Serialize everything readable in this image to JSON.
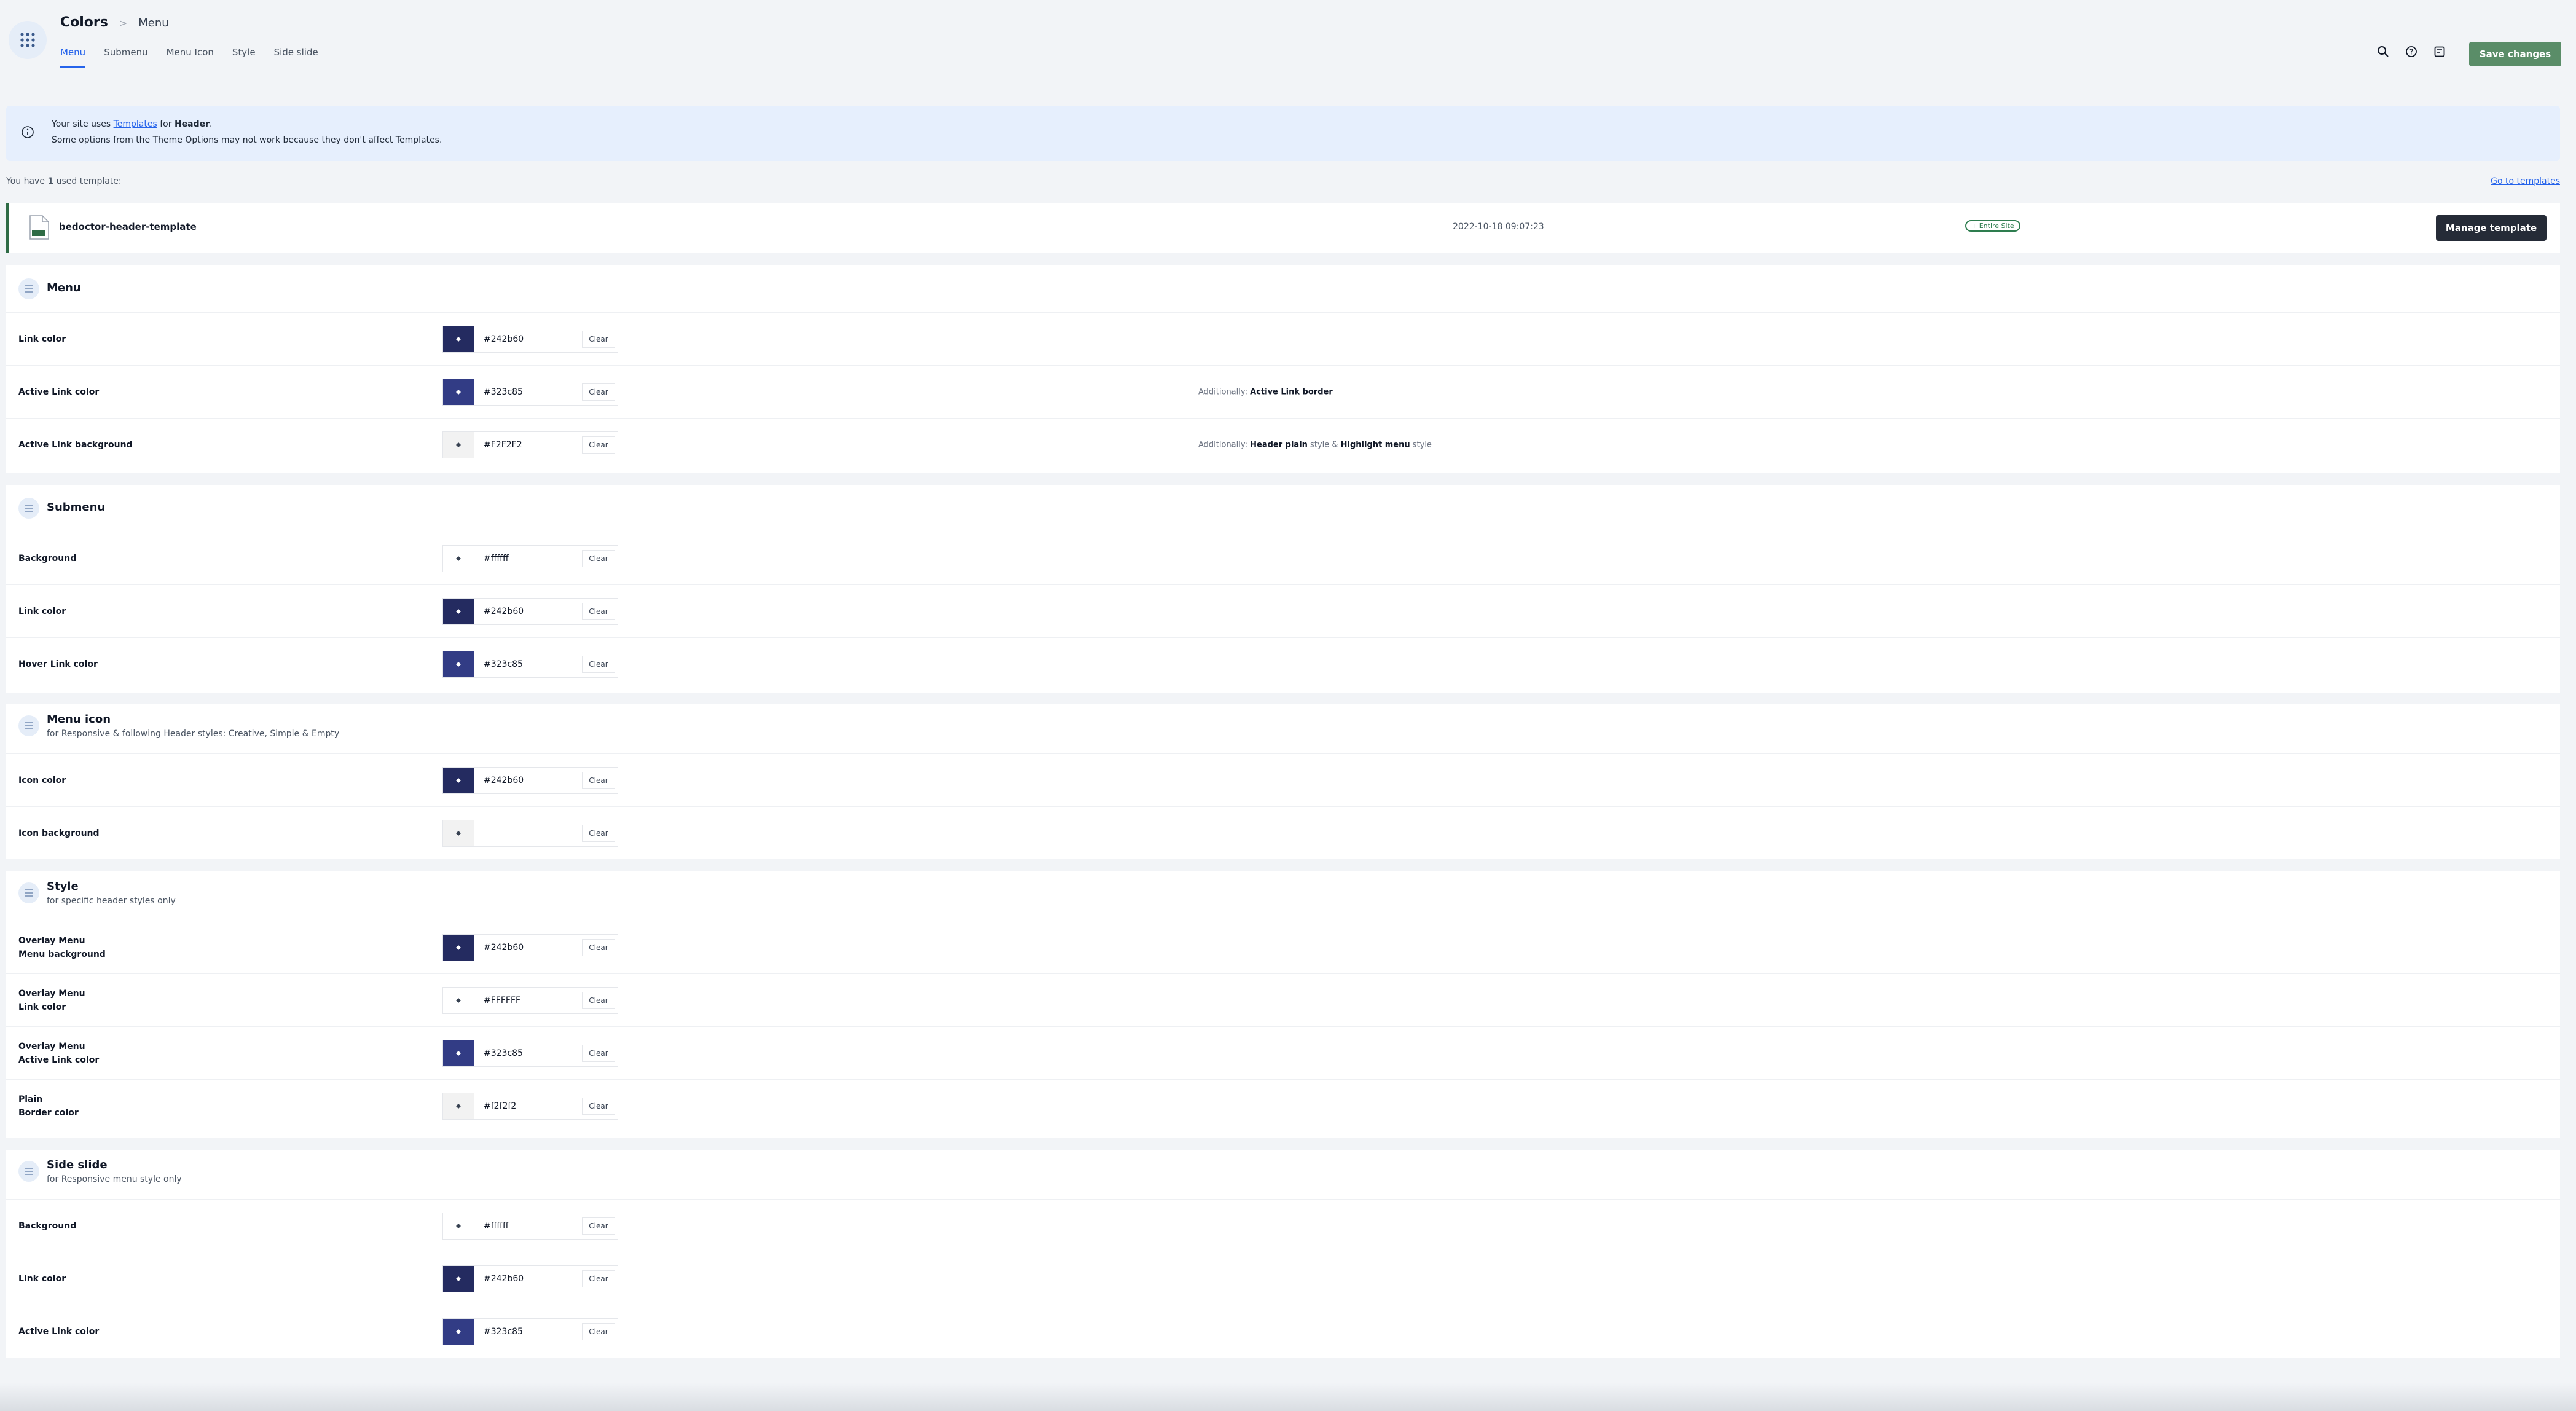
{
  "header": {
    "breadcrumb_main": "Colors",
    "breadcrumb_sep": ">",
    "breadcrumb_sub": "Menu",
    "tabs": [
      {
        "label": "Menu",
        "active": true
      },
      {
        "label": "Submenu",
        "active": false
      },
      {
        "label": "Menu Icon",
        "active": false
      },
      {
        "label": "Style",
        "active": false
      },
      {
        "label": "Side slide",
        "active": false
      }
    ],
    "icons": [
      "search-icon",
      "help-icon",
      "notes-icon"
    ],
    "save_label": "Save changes"
  },
  "notice": {
    "line1_pre": "Your site uses ",
    "line1_link": "Templates",
    "line1_mid": " for ",
    "line1_bold": "Header",
    "line1_post": ".",
    "line2": "Some options from the Theme Options may not work because they don't affect Templates."
  },
  "templates": {
    "count_pre": "You have ",
    "count": "1",
    "count_post": " used template:",
    "goto_label": "Go to templates",
    "item": {
      "name": "bedoctor-header-template",
      "date": "2022-10-18 09:07:23",
      "badge": "+ Entire Site",
      "manage_label": "Manage template"
    }
  },
  "sections": {
    "menu": {
      "title": "Menu",
      "rows": [
        {
          "label": "Link color",
          "value": "#242b60",
          "swatch": "#242b60"
        },
        {
          "label": "Active Link color",
          "value": "#323c85",
          "swatch": "#323c85",
          "note_pre": "Additionally: ",
          "note_b1": "Active Link border",
          "note_mid": "",
          "note_b2": "",
          "note_post": ""
        },
        {
          "label": "Active Link background",
          "value": "#F2F2F2",
          "swatch": "#F2F2F2",
          "note_pre": "Additionally: ",
          "note_b1": "Header plain",
          "note_mid": " style & ",
          "note_b2": "Highlight menu",
          "note_post": " style"
        }
      ]
    },
    "submenu": {
      "title": "Submenu",
      "rows": [
        {
          "label": "Background",
          "value": "#ffffff",
          "swatch": "#ffffff"
        },
        {
          "label": "Link color",
          "value": "#242b60",
          "swatch": "#242b60"
        },
        {
          "label": "Hover Link color",
          "value": "#323c85",
          "swatch": "#323c85"
        }
      ]
    },
    "menu_icon": {
      "title": "Menu icon",
      "subtitle": "for Responsive & following Header styles: Creative, Simple & Empty",
      "rows": [
        {
          "label": "Icon color",
          "value": "#242b60",
          "swatch": "#242b60"
        },
        {
          "label": "Icon background",
          "value": "",
          "swatch": "#f2f2f2"
        }
      ]
    },
    "style": {
      "title": "Style",
      "subtitle": "for specific header styles only",
      "rows": [
        {
          "label1": "Overlay Menu",
          "label2": "Menu background",
          "value": "#242b60",
          "swatch": "#242b60"
        },
        {
          "label1": "Overlay Menu",
          "label2": "Link color",
          "value": "#FFFFFF",
          "swatch": "#ffffff"
        },
        {
          "label1": "Overlay Menu",
          "label2": "Active Link color",
          "value": "#323c85",
          "swatch": "#323c85"
        },
        {
          "label1": "Plain",
          "label2": "Border color",
          "value": "#f2f2f2",
          "swatch": "#f2f2f2"
        }
      ]
    },
    "side_slide": {
      "title": "Side slide",
      "subtitle": "for Responsive menu style only",
      "rows": [
        {
          "label": "Background",
          "value": "#ffffff",
          "swatch": "#ffffff"
        },
        {
          "label": "Link color",
          "value": "#242b60",
          "swatch": "#242b60"
        },
        {
          "label": "Active Link color",
          "value": "#323c85",
          "swatch": "#323c85"
        }
      ]
    }
  },
  "clear_label": "Clear",
  "colors": {
    "accent": "#2563eb",
    "save": "#5a8d68",
    "dark_button": "#252b37"
  }
}
